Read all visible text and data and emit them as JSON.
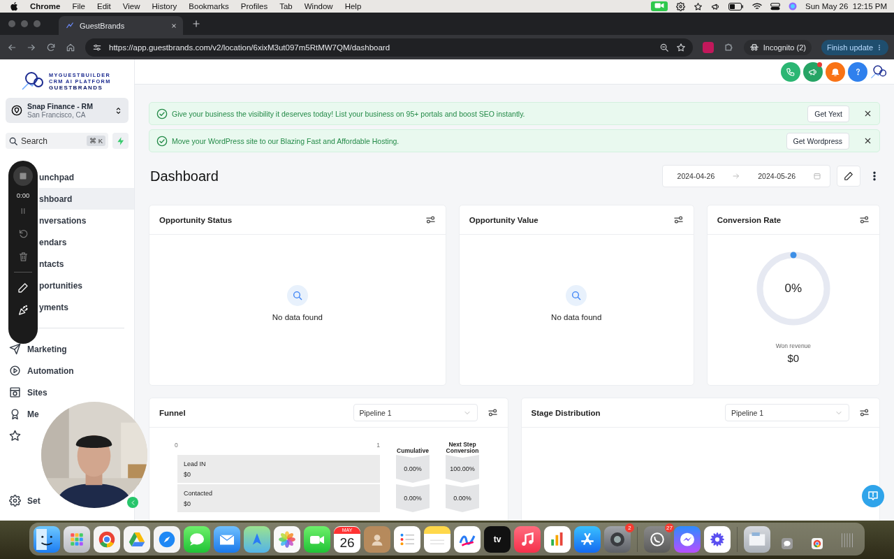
{
  "menu_bar": {
    "app": "Chrome",
    "menus": [
      "File",
      "Edit",
      "View",
      "History",
      "Bookmarks",
      "Profiles",
      "Tab",
      "Window",
      "Help"
    ],
    "clock": "Sun May 26  12:15 PM"
  },
  "browser": {
    "tabs": [
      {
        "title": "GuestBrands",
        "selected": true
      }
    ],
    "url": "https://app.guestbrands.com/v2/location/6xixM3ut097m5RtMW7QM/dashboard",
    "profile": "Incognito (2)",
    "update_button": "Finish update"
  },
  "sidebar": {
    "logo": [
      "MYGUESTBUILDER",
      "CRM AI PLATFORM",
      "GUESTBRANDS"
    ],
    "location": {
      "name": "Snap Finance - RM",
      "address": "San Francisco, CA"
    },
    "search": {
      "placeholder": "Search",
      "shortcut": "⌘ K"
    },
    "nav": [
      {
        "label": "unchpad",
        "selected": false
      },
      {
        "label": "shboard",
        "selected": true
      },
      {
        "label": "nversations",
        "selected": false
      },
      {
        "label": "endars",
        "selected": false
      },
      {
        "label": "ntacts",
        "selected": false
      },
      {
        "label": "portunities",
        "selected": false
      },
      {
        "label": "yments",
        "selected": false
      }
    ],
    "nav_lower": [
      {
        "label": "Marketing",
        "selected": false
      },
      {
        "label": "Automation",
        "selected": false
      },
      {
        "label": "Sites",
        "selected": false
      },
      {
        "label": "Me",
        "selected": false
      },
      {
        "selected": false
      }
    ],
    "settings": {
      "label": "Set"
    }
  },
  "recorder": {
    "timer": "0:00"
  },
  "banners": [
    {
      "text": "Give your business the visibility it deserves today! List your business on 95+ portals and boost SEO instantly.",
      "button": "Get Yext"
    },
    {
      "text": "Move your WordPress site to our Blazing Fast and Affordable Hosting.",
      "button": "Get Wordpress"
    }
  ],
  "dashboard": {
    "title": "Dashboard",
    "date_from": "2024-04-26",
    "date_to": "2024-05-26"
  },
  "cards": [
    {
      "title": "Opportunity Status",
      "kind": "empty",
      "message": "No data found"
    },
    {
      "title": "Opportunity Value",
      "kind": "empty",
      "message": "No data found"
    },
    {
      "title": "Conversion Rate",
      "kind": "gauge",
      "level": 0,
      "value": "0%",
      "caption": "Won revenue",
      "amount": "$0"
    }
  ],
  "funnel": {
    "title": "Funnel",
    "pipeline": "Pipeline 1",
    "ticks": [
      "0",
      "1"
    ],
    "columns": [
      "Cumulative",
      "Next Step Conversion"
    ],
    "stages": [
      {
        "name": "Lead IN",
        "amount": "$0",
        "cumulative": "0.00%",
        "next_step": "100.00%"
      },
      {
        "name": "Contacted",
        "amount": "$0",
        "cumulative": "0.00%",
        "next_step": "0.00%"
      }
    ]
  },
  "stage_distribution": {
    "title": "Stage Distribution",
    "pipeline": "Pipeline 1"
  },
  "dock": [
    {
      "kind": "finder"
    },
    {
      "kind": "launchpad"
    },
    {
      "kind": "chrome"
    },
    {
      "kind": "drive"
    },
    {
      "kind": "safari"
    },
    {
      "kind": "messages"
    },
    {
      "kind": "mail"
    },
    {
      "kind": "maps"
    },
    {
      "kind": "photos"
    },
    {
      "kind": "facetime"
    },
    {
      "kind": "calendar",
      "month": "MAY",
      "day": "26"
    },
    {
      "kind": "contacts"
    },
    {
      "kind": "reminders"
    },
    {
      "kind": "notes"
    },
    {
      "kind": "freeform"
    },
    {
      "kind": "tv",
      "label": "tv"
    },
    {
      "kind": "music"
    },
    {
      "kind": "numbers"
    },
    {
      "kind": "appstore"
    },
    {
      "kind": "settings",
      "badge": "2"
    },
    {
      "kind": "separator"
    },
    {
      "kind": "whatsapp",
      "badge": "27"
    },
    {
      "kind": "messenger"
    },
    {
      "kind": "flower"
    },
    {
      "kind": "separator"
    },
    {
      "kind": "folder"
    },
    {
      "kind": "mini-chat"
    },
    {
      "kind": "mini-chrome"
    },
    {
      "kind": "trash"
    }
  ]
}
